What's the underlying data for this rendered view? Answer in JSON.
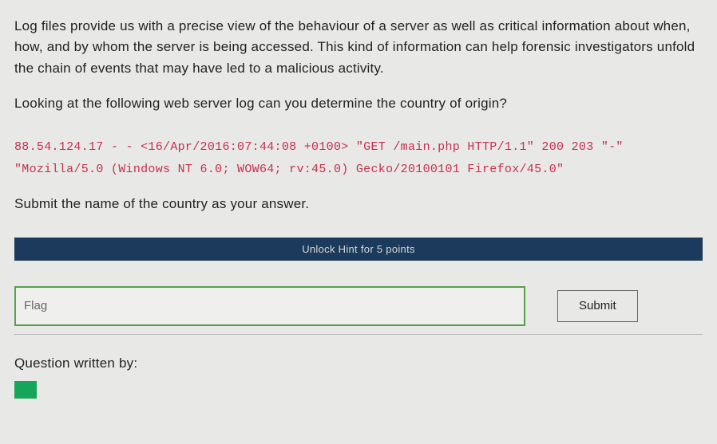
{
  "description": "Log files provide us with a precise view of the behaviour of a server as well as critical information about when, how, and by whom the server is being accessed. This kind of information can help forensic investigators unfold the chain of events that may have led to a malicious activity.",
  "question": "Looking at the following web server log can you determine the country of origin?",
  "log_line": "88.54.124.17 - - <16/Apr/2016:07:44:08 +0100> \"GET /main.php HTTP/1.1\" 200 203 \"-\" \"Mozilla/5.0 (Windows NT 6.0; WOW64; rv:45.0) Gecko/20100101 Firefox/45.0\"",
  "instruction": "Submit the name of the country as your answer.",
  "hint": {
    "label": "Unlock Hint for 5 points"
  },
  "answer": {
    "placeholder": "Flag",
    "value": ""
  },
  "submit_label": "Submit",
  "author_label": "Question written by:"
}
